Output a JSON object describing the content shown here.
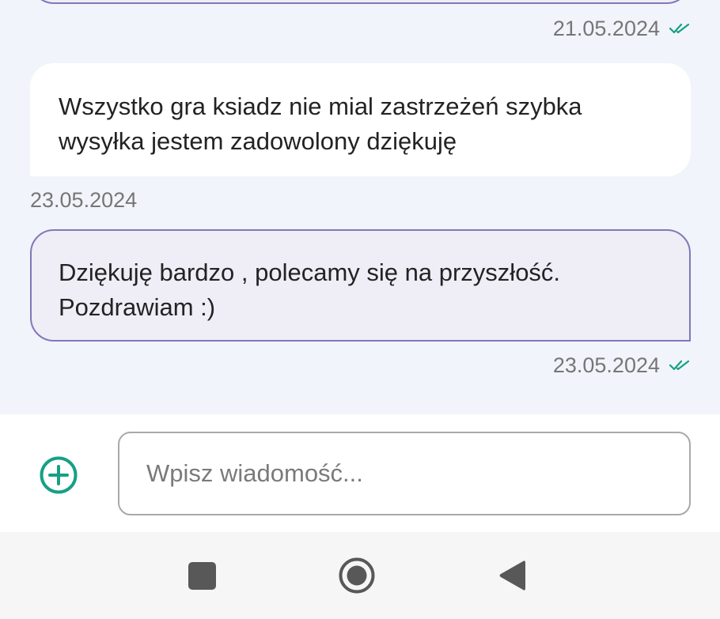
{
  "messages": [
    {
      "direction": "out",
      "text": "",
      "timestamp": "21.05.2024",
      "status": "read"
    },
    {
      "direction": "in",
      "text": "Wszystko gra ksiadz nie mial zastrzeżeń szybka\nwysyłka jestem zadowolony dziękuję",
      "timestamp": "23.05.2024"
    },
    {
      "direction": "out",
      "text": "Dziękuję bardzo , polecamy się na przyszłość.\nPozdrawiam :)",
      "timestamp": "23.05.2024",
      "status": "read"
    }
  ],
  "composer": {
    "placeholder": "Wpisz wiadomość...",
    "value": "",
    "add_icon": "plus-circle-icon"
  },
  "navbar": {
    "icons": [
      "recents-square-icon",
      "home-circle-icon",
      "back-triangle-icon"
    ]
  },
  "colors": {
    "accent": "#16a085",
    "outgoing_bubble": "#efedf6",
    "outgoing_border": "#7f78b8",
    "incoming_bubble": "#ffffff",
    "chat_background": "#f1f4fa",
    "timestamp": "#767676"
  }
}
